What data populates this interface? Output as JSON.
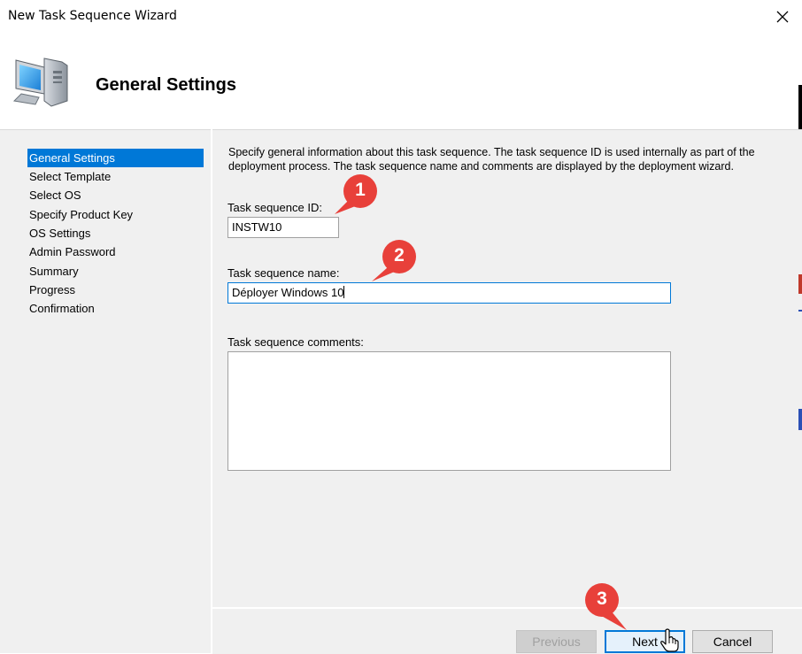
{
  "window": {
    "title": "New Task Sequence Wizard"
  },
  "header": {
    "title": "General Settings"
  },
  "nav": {
    "items": [
      {
        "label": "General Settings",
        "active": true
      },
      {
        "label": "Select Template",
        "active": false
      },
      {
        "label": "Select OS",
        "active": false
      },
      {
        "label": "Specify Product Key",
        "active": false
      },
      {
        "label": "OS Settings",
        "active": false
      },
      {
        "label": "Admin Password",
        "active": false
      },
      {
        "label": "Summary",
        "active": false
      },
      {
        "label": "Progress",
        "active": false
      },
      {
        "label": "Confirmation",
        "active": false
      }
    ]
  },
  "main": {
    "description": "Specify general information about this task sequence.  The task sequence ID is used internally as part of the deployment process.  The task sequence name and comments are displayed by the deployment wizard.",
    "id_label": "Task sequence ID:",
    "id_value": "INSTW10",
    "name_label": "Task sequence name:",
    "name_value": "Déployer Windows 10",
    "comments_label": "Task sequence comments:",
    "comments_value": ""
  },
  "footer": {
    "previous_label": "Previous",
    "next_label": "Next",
    "cancel_label": "Cancel"
  },
  "annotations": {
    "badge1": "1",
    "badge2": "2",
    "badge3": "3",
    "color": "#e8403a"
  },
  "colors": {
    "accent": "#0078d7",
    "panel": "#f0f0f0"
  },
  "icons": [
    "computer-icon",
    "close-icon",
    "hand-cursor-icon"
  ]
}
